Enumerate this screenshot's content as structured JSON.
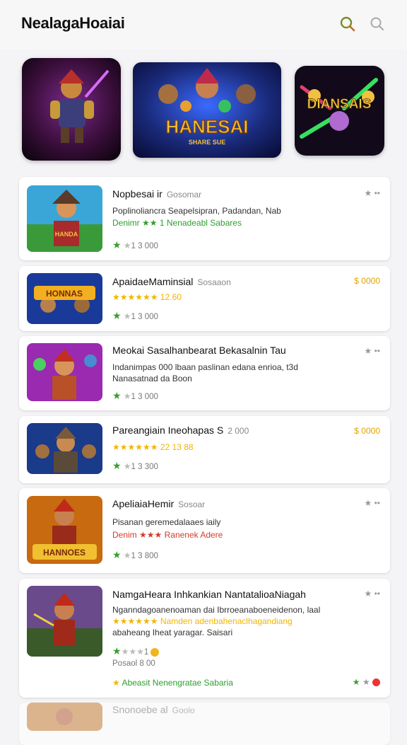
{
  "header": {
    "title": "NealagaHoaiai",
    "icons": [
      "search-icon",
      "search-icon"
    ]
  },
  "banners": [
    "hero-art-1",
    "HANESAI",
    "DIANSAIS"
  ],
  "banner_text": {
    "b2_main": "HANESAI",
    "b2_sub": "SHARE SUE",
    "b3_main": "DIANSAIS"
  },
  "cards": [
    {
      "name": "Nopbesai ir",
      "sub": "Gosomar",
      "desc1": "Poplinoliancra Seapelsipran, Padandan, Nab",
      "desc2": "Denimr ★★ 1 Nenadeabl Sabares",
      "rating": "1 3 000",
      "thumb_text": "HANDA"
    },
    {
      "name": "ApaidaeMaminsial",
      "sub": "Sosaaon",
      "price": "$ 0000",
      "desc1": "★★★★★★ 12.60",
      "rating": "1 3 000",
      "thumb_text": "HONNAS"
    },
    {
      "name": "Meokai Sasalhanbearat Bekasalnin Tau",
      "sub": "",
      "desc1": "Indanimpas 000 lbaan paslinan edana enrioa, t3d",
      "desc2": "Nanasatnad da Boon",
      "rating": "1 3 000"
    },
    {
      "name": "Pareangiain Ineohapas S",
      "sub": "2 000",
      "price": "$ 0000",
      "desc1": "★★★★★★ 22 13 88",
      "rating": "1 3 300"
    },
    {
      "name": "ApeliaiaHemir",
      "sub": "Sosoar",
      "desc1": "Pisanan geremedalaaes iaily",
      "desc2": "Denim ★★★ Ranenek Adere",
      "rating": "1 3 800",
      "thumb_text": "HANNOES"
    },
    {
      "name": "NamgaHeara Inhkankian NantatalioaNiagah",
      "sub": "",
      "desc1": "Nganndagoanenoaman dai Ibrroeanaboeneidenon, laal",
      "desc2": "★★★★★★ Namden adenbahenaclhagandiang",
      "desc3": "abaheang Iheat yaragar. Saisari",
      "rating2": "Posaol 8 00",
      "bottom": "Abeasit Nenengratae Sabaria"
    },
    {
      "name": "Snonoebe al",
      "sub": "Goolo"
    }
  ],
  "colors": {
    "green": "#2e9e2e",
    "gold": "#f3b400",
    "red": "#d23c2c"
  }
}
